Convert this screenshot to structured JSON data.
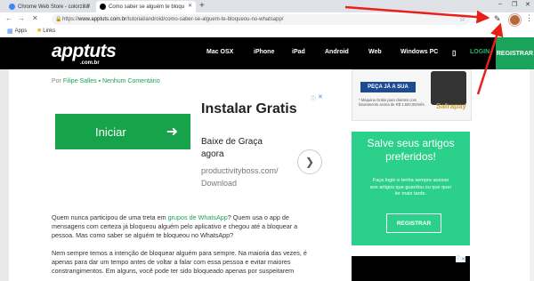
{
  "browser": {
    "tabs": [
      {
        "label": "Chrome Web Store - colorzilla"
      },
      {
        "label": "Como saber se alguém te bloqu"
      }
    ],
    "url_prefix": "https://",
    "url_host": "www.apptuts.com.br",
    "url_path": "/tutorial/android/como-saber-se-alguem-te-bloqueou-no-whatsapp/",
    "bookmarks": [
      {
        "label": "Apps"
      },
      {
        "label": "Links"
      }
    ]
  },
  "site": {
    "logo": "apptuts",
    "logo_sub": ".com.br",
    "nav": [
      "Mac OSX",
      "iPhone",
      "iPad",
      "Android",
      "Web",
      "Windows PC"
    ],
    "login": "LOGIN",
    "register": "REGISTRAR"
  },
  "article": {
    "byline_prefix": "Por",
    "author": "Filipe Salles",
    "comments": "Nenhum Comentário",
    "p1_a": "Quem nunca participou de uma treta em ",
    "p1_link": "grupos de WhatsApp",
    "p1_b": "? Quem usa o app de",
    "p1_l2": "mensagens com certeza já bloqueou alguém pelo aplicativo e chegou até a bloquear a",
    "p1_l3": "pessoa. Mas como saber se alguém te bloqueou no WhatsApp?",
    "p2_l1": "Nem sempre temos a intenção de bloquear alguém para sempre. Na maioria das vezes, é",
    "p2_l2": "apenas para dar um tempo antes de voltar a falar com essa pessoa e evitar maiores",
    "p2_l3": "constrangimentos. Em alguns, você pode ter sido bloqueado apenas por suspeitarem"
  },
  "ad": {
    "button": "Iniciar",
    "title": "Instalar Gratis",
    "line1": "Baixe de Graça",
    "line2": "agora",
    "line3": "productivityboss.com/",
    "line4": "Download"
  },
  "sidebar_ad": {
    "cta": "PEÇA JÁ A SUA",
    "fine1": "* Máquina Grátis para clientes com",
    "fine2": "faturamento acima de R$ 1.500,00/mês.",
    "brand": "Safrapay"
  },
  "promo": {
    "title_l1": "Salve seus artigos",
    "title_l2": "preferidos!",
    "text_l1": "Faça login e tenha sempre acesso",
    "text_l2": "aos artigos que guardou ou que quer",
    "text_l3": "ler mais tarde.",
    "button": "REGISTRAR"
  }
}
